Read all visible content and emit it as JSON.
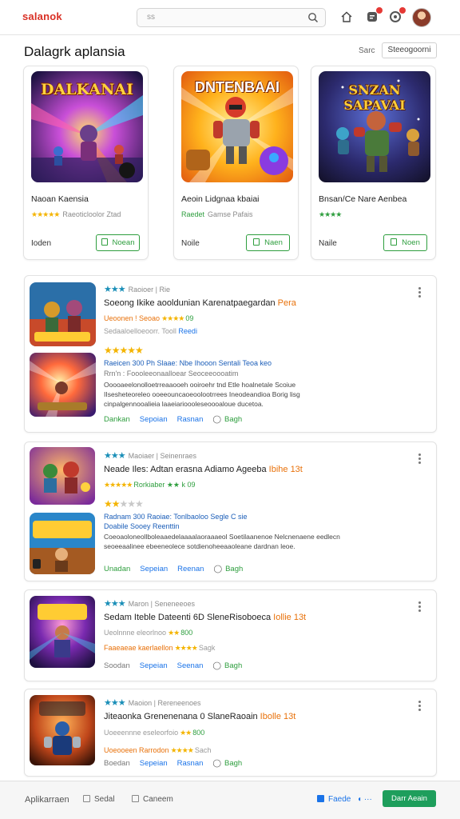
{
  "header": {
    "logo": "salanok",
    "search_placeholder": "ss",
    "icons": [
      "home-icon",
      "notification-icon",
      "messages-icon"
    ],
    "brand_color": "#d93025"
  },
  "page": {
    "title": "Dalagrk aplansia",
    "sort_label": "Sarc",
    "sort_value": "Steeogoorni"
  },
  "featured": [
    {
      "art_text": "DALKANAI",
      "title": "Naoan Kaensia",
      "stars": "★★★★★",
      "meta": "Raeoticloolor Ztad",
      "price": "Ioden",
      "button": "Noean"
    },
    {
      "art_text": "DNTENBAAI",
      "title": "Aeoin Lidgnaa kbaiai",
      "tag": "Raedet",
      "meta": "Gamse Pafais",
      "price": "Noile",
      "button": "Naen"
    },
    {
      "art_text": "SNZAN SAPAVAI",
      "title": "Bnsan/Ce Nare Aenbea",
      "stars": "★★★★",
      "meta": "",
      "price": "Naile",
      "button": "Noen"
    }
  ],
  "list": [
    {
      "category_stars": "★★★",
      "category": "Raoioer | Rie",
      "title": "Soeong Ikike aooldunian Karenatpaegardan",
      "title_accent": "Pera",
      "sub_prefix": "Ueoonen ! Seoao",
      "sub_stars": "★★★★",
      "sub_suffix": "09",
      "sub2": "Sedaaloelloeoorr. Tooll",
      "sub2_blue": "Reedi",
      "rating_on": "★★★★★",
      "rating_off": "",
      "blue_line": "Raeicen  300 Ph Slaae: Nbe Ihooon Sentali Teoa keo",
      "grey_line": "Rrn'n : Foooleeonaalloear Seoceeoooatim",
      "desc": "Ooooaeelonolloetrreaaooeh ooiroehr tnd Etle hoalnetale Scoiue IIsesheteoreleo ooeeouncaoeoolootrrees Ineodeandioa Borig lisg cinpalgennooalieia laaeiarioooleseoooaloue ducetoa.",
      "actions": [
        "Dankan",
        "Sepoian",
        "Rasnan",
        "Bagh"
      ]
    },
    {
      "category_stars": "★★★",
      "category": "Maoiaer | Seinenraes",
      "title": "Neade Iles: Adtan erasna Adiamo Ageeba",
      "title_accent": "Ibihe 13t",
      "sub_prefix": "",
      "sub_stars": "★★★★★",
      "sub_suffix": "Rorkiaber ★★ k 09",
      "sub2": "",
      "sub2_blue": "",
      "rating_on": "★★",
      "rating_off": "★★★",
      "blue_line": "Radnam  300 Raoiae: Tonlbaoloo Segle C sie",
      "grey_line": "Doabile  Sooey Reenttin",
      "desc": "Coeoaoloneollboleaaedelaaaalaoraaaeol Soetilaanenoe Nelcnenaene eedlecn seoeeaalinee ebeeneolece sotdienoheeaaoleane dardnan leoe.",
      "actions": [
        "Unadan",
        "Sepeian",
        "Reenan",
        "Bagh"
      ]
    },
    {
      "category_stars": "★★★",
      "category": "Maron | Seneneeoes",
      "title": "Sedam Iteble Dateenti 6D SleneRisoboeca",
      "title_accent": "Iollie 13t",
      "sub_prefix": "Ueolnnne eleorlnoo",
      "sub_stars": "★★",
      "sub_suffix": "800",
      "sub2": "Faaeaeae kaerlaellon",
      "sub2_stars": "★★★★",
      "sub2_tail": "Sagk",
      "rating_on": "",
      "rating_off": "",
      "blue_line": "",
      "grey_line": "",
      "desc": "",
      "actions": [
        "Soodan",
        "Sepeian",
        "Seenan",
        "Bagh"
      ]
    },
    {
      "category_stars": "★★★",
      "category": "Maoion | Rereneenoes",
      "title": "Jiteaonka Grenenenana 0 SlaneRaoain",
      "title_accent": "Ibolle 13t",
      "sub_prefix": "Uoeeennne eseleorfoio",
      "sub_stars": "★★",
      "sub_suffix": "800",
      "sub2": "Uoeooeen Rarrodon",
      "sub2_stars": "★★★★",
      "sub2_tail": "Sach",
      "rating_on": "",
      "rating_off": "",
      "blue_line": "",
      "grey_line": "",
      "desc": "",
      "actions": [
        "Boedan",
        "Sepeian",
        "Rasnan",
        "Bagh"
      ]
    }
  ],
  "footer": {
    "brand": "Aplikarraen",
    "link1": "Sedal",
    "link2": "Caneem",
    "blue_link": "Faede",
    "cta": "Darr Aeain"
  }
}
